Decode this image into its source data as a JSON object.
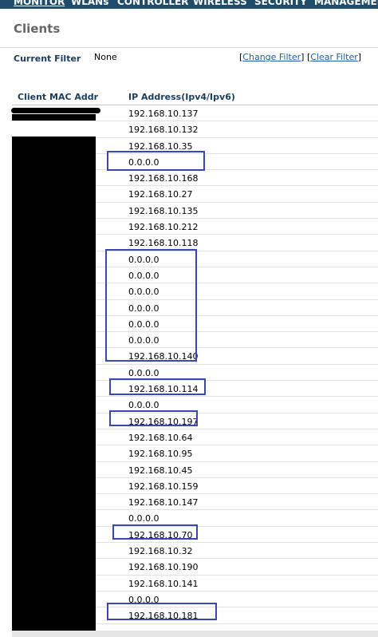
{
  "nav": {
    "items": [
      {
        "label": "MONITOR",
        "active": true
      },
      {
        "label": "WLANs"
      },
      {
        "label": "CONTROLLER"
      },
      {
        "label": "WIRELESS"
      },
      {
        "label": "SECURITY"
      },
      {
        "label": "MANAGEMENT"
      }
    ]
  },
  "page": {
    "title": "Clients"
  },
  "filter": {
    "label": "Current Filter",
    "value": "None",
    "change_link": "Change Filter",
    "clear_link": "Clear Filter"
  },
  "table": {
    "columns": [
      "Client MAC Addr",
      "IP Address(Ipv4/Ipv6)"
    ],
    "rows": [
      {
        "ip": "192.168.10.137"
      },
      {
        "ip": "192.168.10.132"
      },
      {
        "ip": "192.168.10.35"
      },
      {
        "ip": "0.0.0.0"
      },
      {
        "ip": "192.168.10.168"
      },
      {
        "ip": "192.168.10.27"
      },
      {
        "ip": "192.168.10.135"
      },
      {
        "ip": "192.168.10.212"
      },
      {
        "ip": "192.168.10.118"
      },
      {
        "ip": "0.0.0.0"
      },
      {
        "ip": "0.0.0.0"
      },
      {
        "ip": "0.0.0.0"
      },
      {
        "ip": "0.0.0.0"
      },
      {
        "ip": "0.0.0.0"
      },
      {
        "ip": "0.0.0.0"
      },
      {
        "ip": "192.168.10.140"
      },
      {
        "ip": "0.0.0.0"
      },
      {
        "ip": "192.168.10.114"
      },
      {
        "ip": "0.0.0.0"
      },
      {
        "ip": "192.168.10.197"
      },
      {
        "ip": "192.168.10.64"
      },
      {
        "ip": "192.168.10.95"
      },
      {
        "ip": "192.168.10.45"
      },
      {
        "ip": "192.168.10.159"
      },
      {
        "ip": "192.168.10.147"
      },
      {
        "ip": "0.0.0.0"
      },
      {
        "ip": "192.168.10.70"
      },
      {
        "ip": "192.168.10.32"
      },
      {
        "ip": "192.168.10.190"
      },
      {
        "ip": "192.168.10.141"
      },
      {
        "ip": "0.0.0.0"
      },
      {
        "ip": "192.168.10.181"
      }
    ]
  },
  "colors": {
    "nav_bg": "#1f4d69",
    "highlight": "#3b47b0",
    "link": "#1a5fa8"
  }
}
